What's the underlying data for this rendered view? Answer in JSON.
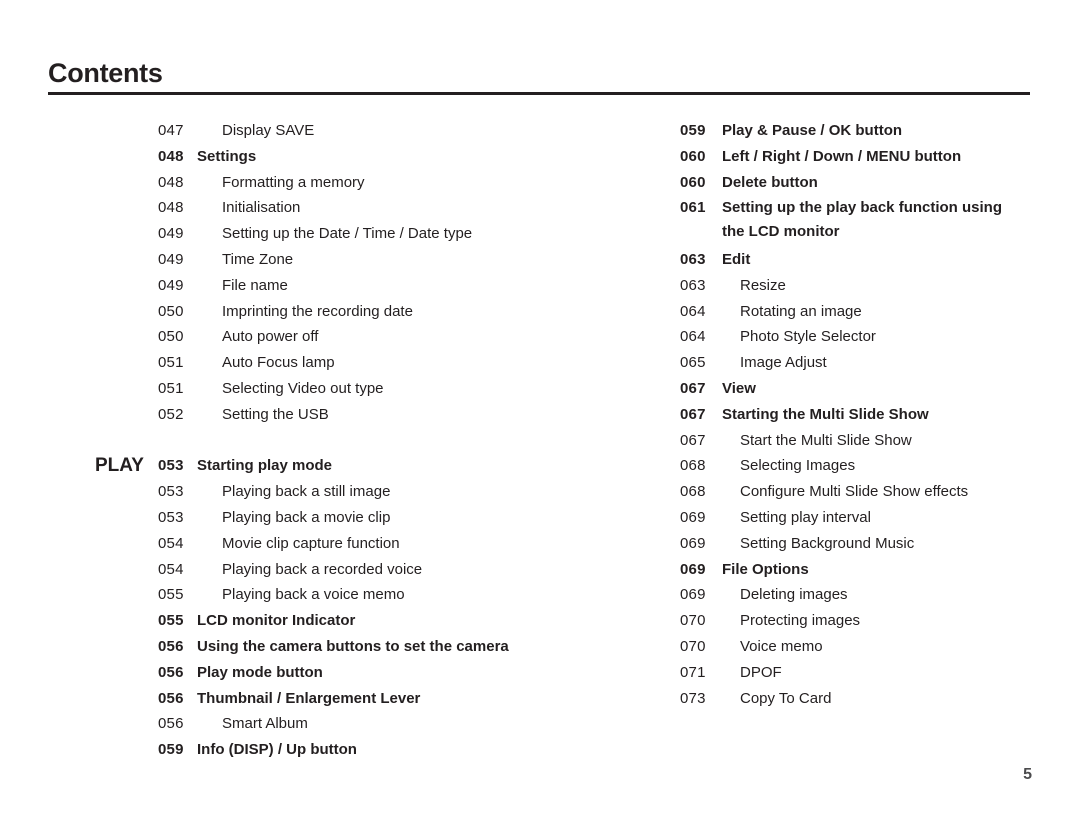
{
  "document": {
    "title": "Contents",
    "page_number": "5"
  },
  "columns": {
    "left": {
      "section_label": "PLAY",
      "entries": [
        {
          "page": "047",
          "label": "Display SAVE",
          "bold": false
        },
        {
          "page": "048",
          "label": "Settings",
          "bold": true
        },
        {
          "page": "048",
          "label": "Formatting a memory",
          "bold": false
        },
        {
          "page": "048",
          "label": "Initialisation",
          "bold": false
        },
        {
          "page": "049",
          "label": "Setting up the Date / Time / Date type",
          "bold": false
        },
        {
          "page": "049",
          "label": "Time Zone",
          "bold": false
        },
        {
          "page": "049",
          "label": "File name",
          "bold": false
        },
        {
          "page": "050",
          "label": "Imprinting the recording date",
          "bold": false
        },
        {
          "page": "050",
          "label": "Auto power off",
          "bold": false
        },
        {
          "page": "051",
          "label": "Auto Focus lamp",
          "bold": false
        },
        {
          "page": "051",
          "label": "Selecting Video out type",
          "bold": false
        },
        {
          "page": "052",
          "label": "Setting the USB",
          "bold": false
        },
        {
          "page": "053",
          "label": "Starting play mode",
          "bold": true,
          "section": "PLAY"
        },
        {
          "page": "053",
          "label": "Playing back a still image",
          "bold": false
        },
        {
          "page": "053",
          "label": "Playing back a movie clip",
          "bold": false
        },
        {
          "page": "054",
          "label": "Movie clip capture function",
          "bold": false
        },
        {
          "page": "054",
          "label": "Playing back a recorded voice",
          "bold": false
        },
        {
          "page": "055",
          "label": "Playing back a voice memo",
          "bold": false
        },
        {
          "page": "055",
          "label": "LCD monitor Indicator",
          "bold": true
        },
        {
          "page": "056",
          "label": "Using the camera buttons to set the camera",
          "bold": true
        },
        {
          "page": "056",
          "label": "Play mode button",
          "bold": true
        },
        {
          "page": "056",
          "label": "Thumbnail / Enlargement Lever",
          "bold": true
        },
        {
          "page": "056",
          "label": "Smart Album",
          "bold": false
        },
        {
          "page": "059",
          "label": "Info (DISP) / Up button",
          "bold": true
        }
      ]
    },
    "right": {
      "entries": [
        {
          "page": "059",
          "label": "Play & Pause / OK button",
          "bold": true
        },
        {
          "page": "060",
          "label": "Left / Right / Down / MENU button",
          "bold": true
        },
        {
          "page": "060",
          "label": "Delete button",
          "bold": true
        },
        {
          "page": "061",
          "label": "Setting up the play back function using",
          "label2": "the LCD monitor",
          "bold": true
        },
        {
          "page": "063",
          "label": "Edit",
          "bold": true
        },
        {
          "page": "063",
          "label": "Resize",
          "bold": false
        },
        {
          "page": "064",
          "label": "Rotating an image",
          "bold": false
        },
        {
          "page": "064",
          "label": "Photo Style Selector",
          "bold": false
        },
        {
          "page": "065",
          "label": "Image Adjust",
          "bold": false
        },
        {
          "page": "067",
          "label": "View",
          "bold": true
        },
        {
          "page": "067",
          "label": "Starting the Multi Slide Show",
          "bold": true
        },
        {
          "page": "067",
          "label": "Start the Multi Slide Show",
          "bold": false
        },
        {
          "page": "068",
          "label": "Selecting Images",
          "bold": false
        },
        {
          "page": "068",
          "label": "Configure Multi Slide Show effects",
          "bold": false
        },
        {
          "page": "069",
          "label": "Setting play interval",
          "bold": false
        },
        {
          "page": "069",
          "label": "Setting Background Music",
          "bold": false
        },
        {
          "page": "069",
          "label": "File Options",
          "bold": true
        },
        {
          "page": "069",
          "label": "Deleting images",
          "bold": false
        },
        {
          "page": "070",
          "label": "Protecting images",
          "bold": false
        },
        {
          "page": "070",
          "label": "Voice memo",
          "bold": false
        },
        {
          "page": "071",
          "label": "DPOF",
          "bold": false
        },
        {
          "page": "073",
          "label": "Copy To Card",
          "bold": false
        }
      ]
    }
  }
}
